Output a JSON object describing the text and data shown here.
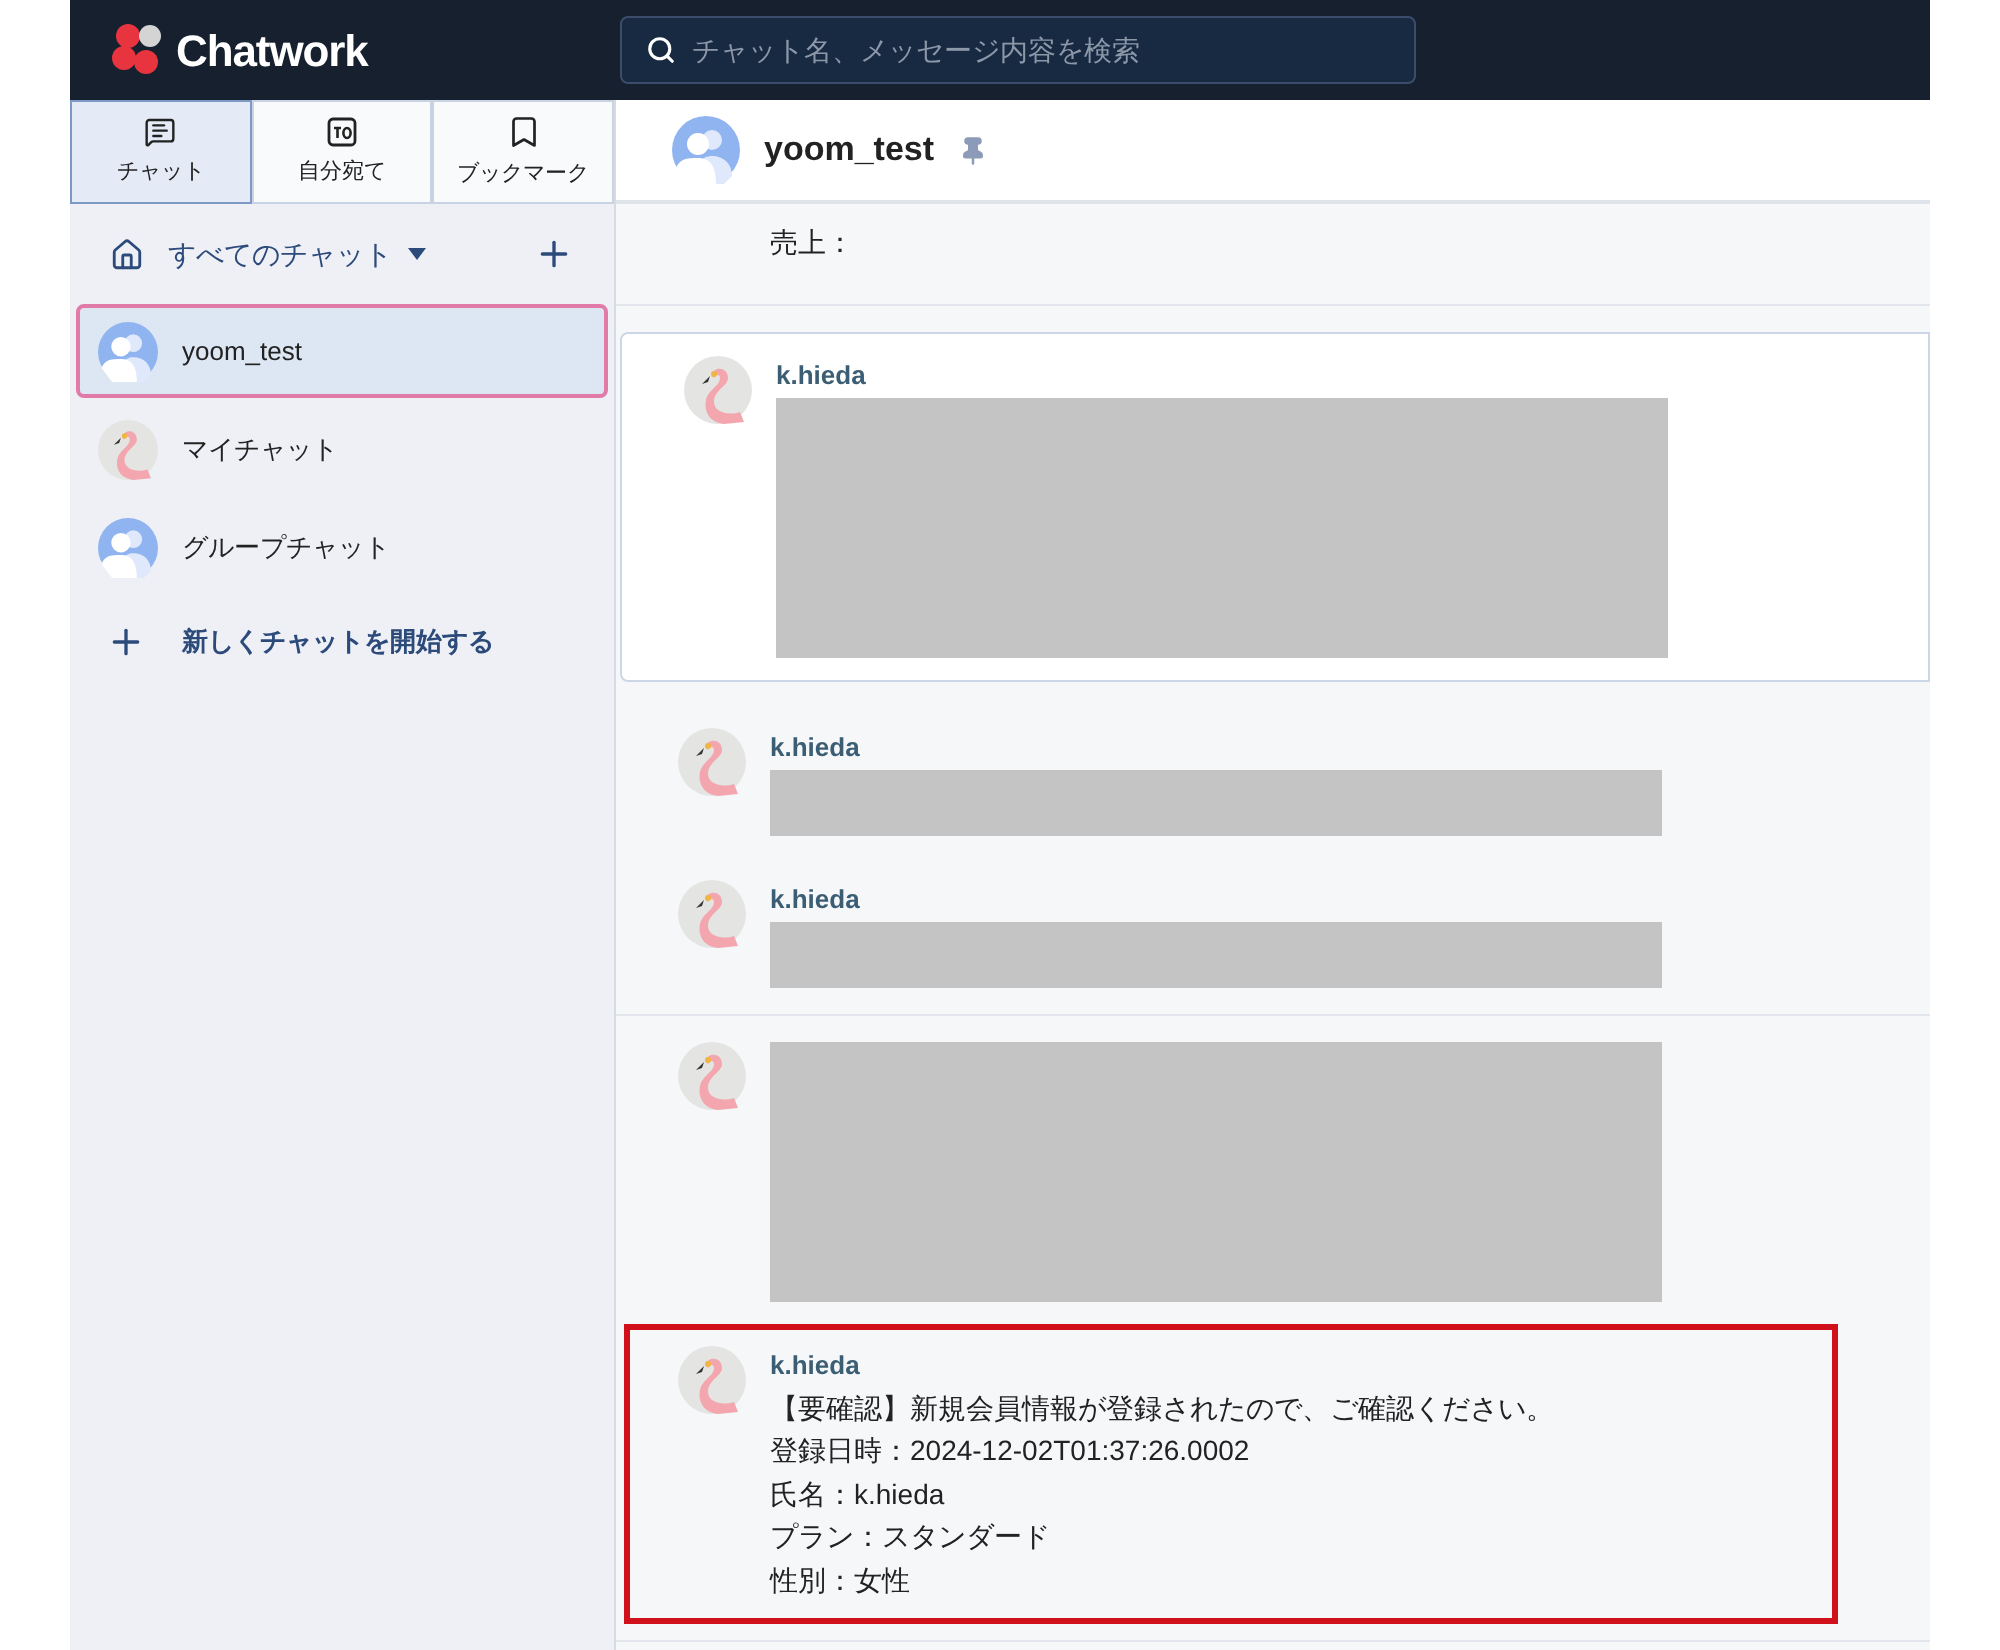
{
  "header": {
    "logo": "Chatwork",
    "search": {
      "placeholder": "チャット名、メッセージ内容を検索"
    }
  },
  "tabs": [
    {
      "label": "チャット",
      "kind": "chat",
      "selected": true
    },
    {
      "label": "自分宛て",
      "kind": "to",
      "selected": false
    },
    {
      "label": "ブックマーク",
      "kind": "bookmark",
      "selected": false
    }
  ],
  "sidebar": {
    "filter": "すべてのチャット",
    "rooms": [
      {
        "name": "yoom_test",
        "kind": "group",
        "selected": true
      },
      {
        "name": "マイチャット",
        "kind": "personal",
        "selected": false
      },
      {
        "name": "グループチャット",
        "kind": "group",
        "selected": false
      }
    ],
    "new_chat": "新しくチャットを開始する"
  },
  "chat": {
    "title": "yoom_test",
    "pinned": true,
    "sections": [
      {
        "kind": "plain",
        "messages": [
          {
            "kind": "text",
            "highlighted": false,
            "lines": [
              "売上："
            ]
          }
        ]
      },
      {
        "kind": "card",
        "messages": [
          {
            "kind": "block",
            "sender": "k.hieda",
            "highlighted": false
          }
        ]
      },
      {
        "kind": "plain",
        "messages": [
          {
            "kind": "line",
            "sender": "k.hieda",
            "highlighted": false
          },
          {
            "kind": "line",
            "sender": "k.hieda",
            "highlighted": false
          }
        ]
      },
      {
        "kind": "plain",
        "messages": [
          {
            "kind": "block",
            "highlighted": false
          },
          {
            "kind": "text",
            "sender": "k.hieda",
            "highlighted": true,
            "lines": [
              "【要確認】新規会員情報が登録されたので、ご確認ください。",
              "登録日時：2024-12-02T01:37:26.0002",
              "氏名：k.hieda",
              "プラン：スタンダード",
              "性別：女性"
            ]
          }
        ]
      }
    ]
  }
}
